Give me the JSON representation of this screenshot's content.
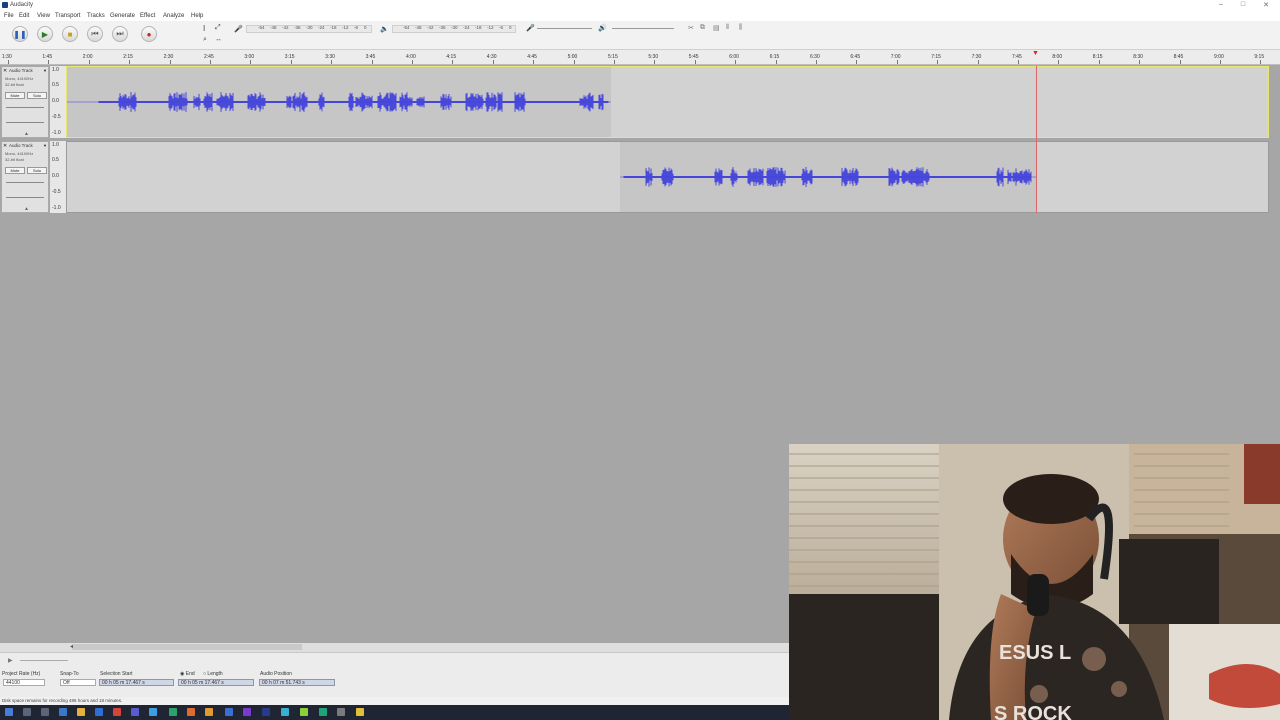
{
  "window": {
    "title": "Audacity"
  },
  "menu": [
    "File",
    "Edit",
    "View",
    "Transport",
    "Tracks",
    "Generate",
    "Effect",
    "Analyze",
    "Help"
  ],
  "meter_scale": [
    "-54",
    "-48",
    "-42",
    "-36",
    "-30",
    "-24",
    "-18",
    "-12",
    "-6",
    "0"
  ],
  "record_meter_scale": [
    "-54",
    "-48",
    "-42",
    "-36",
    "-30",
    "-24",
    "-18",
    "-12",
    "-6",
    "0"
  ],
  "ruler": [
    "1:30",
    "1:45",
    "2:00",
    "2:15",
    "2:30",
    "2:45",
    "3:00",
    "3:15",
    "3:30",
    "3:45",
    "4:00",
    "4:15",
    "4:30",
    "4:45",
    "5:00",
    "5:15",
    "5:30",
    "5:45",
    "6:00",
    "6:15",
    "6:30",
    "6:45",
    "7:00",
    "7:15",
    "7:30",
    "7:45",
    "8:00",
    "8:15",
    "8:30",
    "8:45",
    "9:00",
    "9:15"
  ],
  "tracks": [
    {
      "name": "Audio Track",
      "info1": "Mono, 44100Hz",
      "info2": "32-bit float",
      "mute": "Mute",
      "solo": "Solo",
      "scale": [
        "1.0",
        "0.5",
        "0.0",
        "-0.5",
        "-1.0"
      ]
    },
    {
      "name": "Audio Track",
      "info1": "Mono, 44100Hz",
      "info2": "32-bit float",
      "mute": "Mute",
      "solo": "Solo",
      "scale": [
        "1.0",
        "0.5",
        "0.0",
        "-0.5",
        "-1.0"
      ]
    }
  ],
  "selection": {
    "project_rate_label": "Project Rate (Hz)",
    "project_rate": "44100",
    "snap_label": "Snap-To",
    "snap": "Off",
    "start_label": "Selection Start",
    "start": "00 h 05 m 17.467 s",
    "end_label": "End",
    "length_label": "Length",
    "end": "00 h 05 m 17.467 s",
    "audio_pos_label": "Audio Position",
    "audio_pos": "00 h 07 m 51.743 s"
  },
  "status": "Disk space remains for recording 486 hours and 18 minutes.",
  "colors": {
    "wave": "#3b3bdc",
    "accent_selected": "#ecec7c"
  }
}
